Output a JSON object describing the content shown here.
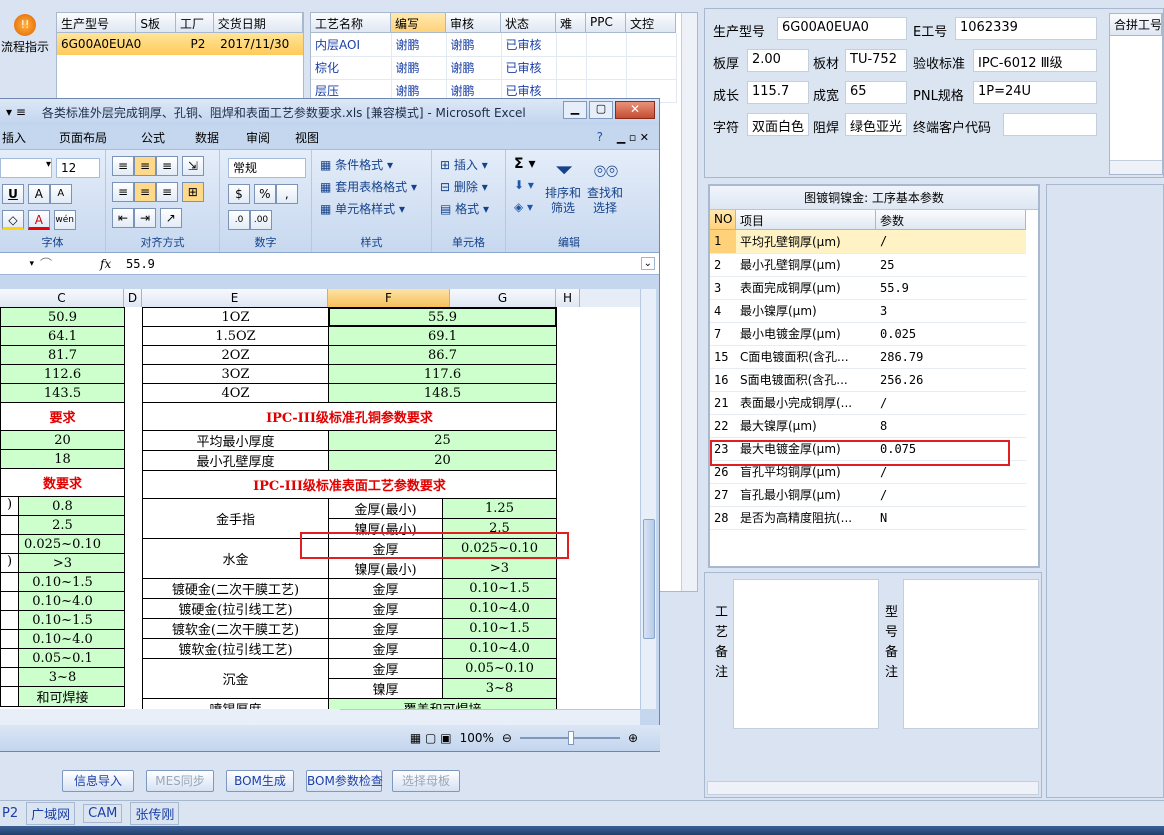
{
  "app": {
    "flow_button": "流程指示",
    "lan_tab": "广域网",
    "cam_tab": "CAM",
    "user_tab": "张传刚",
    "p2_text": "P2"
  },
  "orders": {
    "headers": [
      "生产型号",
      "S板",
      "工厂",
      "交货日期"
    ],
    "row": [
      "6G00A0EUA0",
      "",
      "P2",
      "2017/11/30"
    ]
  },
  "process": {
    "headers": [
      "工艺名称",
      "编写",
      "审核",
      "状态",
      "难",
      "PPC",
      "文控"
    ],
    "rows": [
      [
        "内层AOI",
        "谢鹏",
        "谢鹏",
        "已审核"
      ],
      [
        "棕化",
        "谢鹏",
        "谢鹏",
        "已审核"
      ],
      [
        "层压",
        "谢鹏",
        "谢鹏",
        "已审核"
      ]
    ]
  },
  "info": {
    "model_label": "生产型号",
    "model": "6G00A0EUA0",
    "e_label": "E工号",
    "e_num": "1062339",
    "thick_label": "板厚",
    "thick": "2.00",
    "mat_label": "板材",
    "mat": "TU-752",
    "std_label": "验收标准",
    "std": "IPC-6012 Ⅲ级",
    "len_label": "成长",
    "len": "115.7",
    "wid_label": "成宽",
    "wid": "65",
    "pnl_label": "PNL规格",
    "pnl": "1P=24U",
    "char_label": "字符",
    "char": "双面白色",
    "mask_label": "阻焊",
    "mask": "绿色亚光",
    "cust_label": "终端客户代码",
    "cust": "",
    "combo_label": "合拼工号"
  },
  "params": {
    "title": "图镀铜镍金: 工序基本参数",
    "headers": [
      "NO",
      "项目",
      "参数"
    ],
    "rows": [
      [
        "1",
        "平均孔壁铜厚(μm)",
        "/"
      ],
      [
        "2",
        "最小孔壁铜厚(μm)",
        "25"
      ],
      [
        "3",
        "表面完成铜厚(μm)",
        "55.9"
      ],
      [
        "4",
        "最小镍厚(μm)",
        "3"
      ],
      [
        "7",
        "最小电镀金厚(μm)",
        "0.025"
      ],
      [
        "15",
        "C面电镀面积(含孔...",
        "286.79"
      ],
      [
        "16",
        "S面电镀面积(含孔...",
        "256.26"
      ],
      [
        "21",
        "表面最小完成铜厚(...",
        "/"
      ],
      [
        "22",
        "最大镍厚(μm)",
        "8"
      ],
      [
        "23",
        "最大电镀金厚(μm)",
        "0.075"
      ],
      [
        "26",
        "盲孔平均铜厚(μm)",
        "/"
      ],
      [
        "27",
        "盲孔最小铜厚(μm)",
        "/"
      ],
      [
        "28",
        "是否为高精度阻抗(...",
        "N"
      ]
    ]
  },
  "notes": {
    "process_label": "工艺备注",
    "model_label": "型号备注"
  },
  "buttons": [
    "信息导入",
    "MES同步",
    "BOM生成",
    "BOM参数检查",
    "选择母板"
  ],
  "excel": {
    "title": "各类标准外层完成铜厚、孔铜、阻焊和表面工艺参数要求.xls  [兼容模式] - Microsoft Excel",
    "tabs": [
      "插入",
      "页面布局",
      "公式",
      "数据",
      "审阅",
      "视图"
    ],
    "font_size": "12",
    "number_format": "常规",
    "groups": [
      "字体",
      "对齐方式",
      "数字",
      "样式",
      "单元格",
      "编辑"
    ],
    "style_items": [
      "条件格式",
      "套用表格格式",
      "单元格样式"
    ],
    "cell_items": [
      "插入",
      "删除",
      "格式"
    ],
    "edit_items": [
      "排序和筛选",
      "查找和选择"
    ],
    "formula": "55.9",
    "zoom": "100%",
    "cols": [
      "C",
      "D",
      "E",
      "F",
      "G",
      "H"
    ],
    "rows": [
      {
        "c": "50.9",
        "e": "1OZ",
        "f": "55.9"
      },
      {
        "c": "64.1",
        "e": "1.5OZ",
        "f": "69.1"
      },
      {
        "c": "81.7",
        "e": "2OZ",
        "f": "86.7"
      },
      {
        "c": "112.6",
        "e": "3OZ",
        "f": "117.6"
      },
      {
        "c": "143.5",
        "e": "4OZ",
        "f": "148.5"
      }
    ],
    "hole_left": "要求",
    "hole_title": "IPC-III级标准孔铜参数要求",
    "hole_rows": [
      {
        "c": "20",
        "e": "平均最小厚度",
        "f": "25"
      },
      {
        "c": "18",
        "e": "最小孔壁厚度",
        "f": "20"
      }
    ],
    "surf_left": "数要求",
    "surf_title": "IPC-III级标准表面工艺参数要求",
    "surf_rows": [
      {
        "b": ")",
        "c": "0.8",
        "e": "金手指",
        "f": "金厚(最小)",
        "g": "1.25"
      },
      {
        "b": "",
        "c": "2.5",
        "e": "",
        "f": "镍厚(最小)",
        "g": "2.5"
      },
      {
        "b": "",
        "c": "0.025~0.10",
        "e": "水金",
        "f": "金厚",
        "g": "0.025~0.10"
      },
      {
        "b": ")",
        "c": ">3",
        "e": "",
        "f": "镍厚(最小)",
        "g": ">3"
      },
      {
        "b": "",
        "c": "0.10~1.5",
        "e": "镀硬金(二次干膜工艺)",
        "f": "金厚",
        "g": "0.10~1.5"
      },
      {
        "b": "",
        "c": "0.10~4.0",
        "e": "镀硬金(拉引线工艺)",
        "f": "金厚",
        "g": "0.10~4.0"
      },
      {
        "b": "",
        "c": "0.10~1.5",
        "e": "镀软金(二次干膜工艺)",
        "f": "金厚",
        "g": "0.10~1.5"
      },
      {
        "b": "",
        "c": "0.10~4.0",
        "e": "镀软金(拉引线工艺)",
        "f": "金厚",
        "g": "0.10~4.0"
      },
      {
        "b": "",
        "c": "0.05~0.1",
        "e": "沉金",
        "f": "金厚",
        "g": "0.05~0.10"
      },
      {
        "b": "",
        "c": "3~8",
        "e": "",
        "f": "镍厚",
        "g": "3~8"
      },
      {
        "b": "",
        "c": "和可焊接",
        "e": "喷锡厚度",
        "f": "覆盖和可焊接",
        "g": ""
      }
    ]
  }
}
